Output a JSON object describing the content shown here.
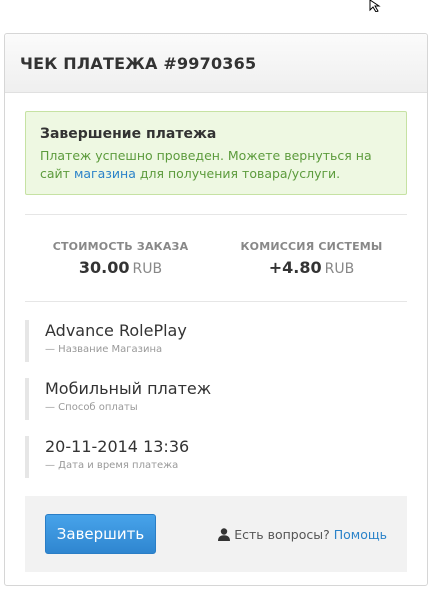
{
  "header": {
    "title": "ЧЕК ПЛАТЕЖА #9970365"
  },
  "alert": {
    "title": "Завершение платежа",
    "text_before": "Платеж успешно проведен. Можете вернуться на сайт",
    "link": "магазина",
    "text_after": "для получения товара/услуги."
  },
  "stats": {
    "order_cost": {
      "label": "СТОИМОСТЬ ЗАКАЗА",
      "value": "30.00",
      "unit": "RUB"
    },
    "commission": {
      "label": "КОМИССИЯ СИСТЕМЫ",
      "value": "+4.80",
      "unit": "RUB"
    }
  },
  "details": [
    {
      "value": "Advance RolePlay",
      "label": "— Название Магазина"
    },
    {
      "value": "Мобильный платеж",
      "label": "— Способ оплаты"
    },
    {
      "value": "20-11-2014 13:36",
      "label": "— Дата и время платежа"
    }
  ],
  "footer": {
    "finish_button": "Завершить",
    "question": "Есть вопросы?",
    "help_link": "Помощь"
  },
  "colors": {
    "accent": "#2b83c9",
    "success_bg": "#eef8e2",
    "success_text": "#5c9b3c"
  },
  "icons": {
    "cursor": "mouse-pointer-icon",
    "user": "user-icon"
  }
}
